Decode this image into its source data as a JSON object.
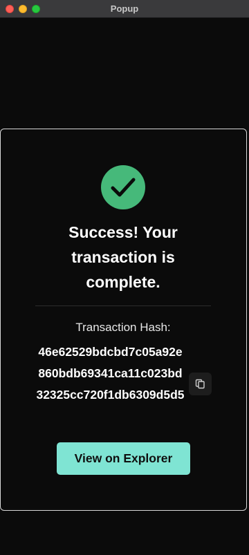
{
  "window": {
    "title": "Popup"
  },
  "success": {
    "icon": "check-circle-icon",
    "accent_color": "#46b97a",
    "heading": "Success! Your transaction is complete."
  },
  "transaction": {
    "hash_label": "Transaction Hash:",
    "hash": "46e62529bdcbd7c05a92e860bdb69341ca11c023bd32325cc720f1db6309d5d5",
    "copy_icon": "copy-icon"
  },
  "actions": {
    "explorer_label": "View on Explorer",
    "explorer_color": "#7fe4d3"
  }
}
